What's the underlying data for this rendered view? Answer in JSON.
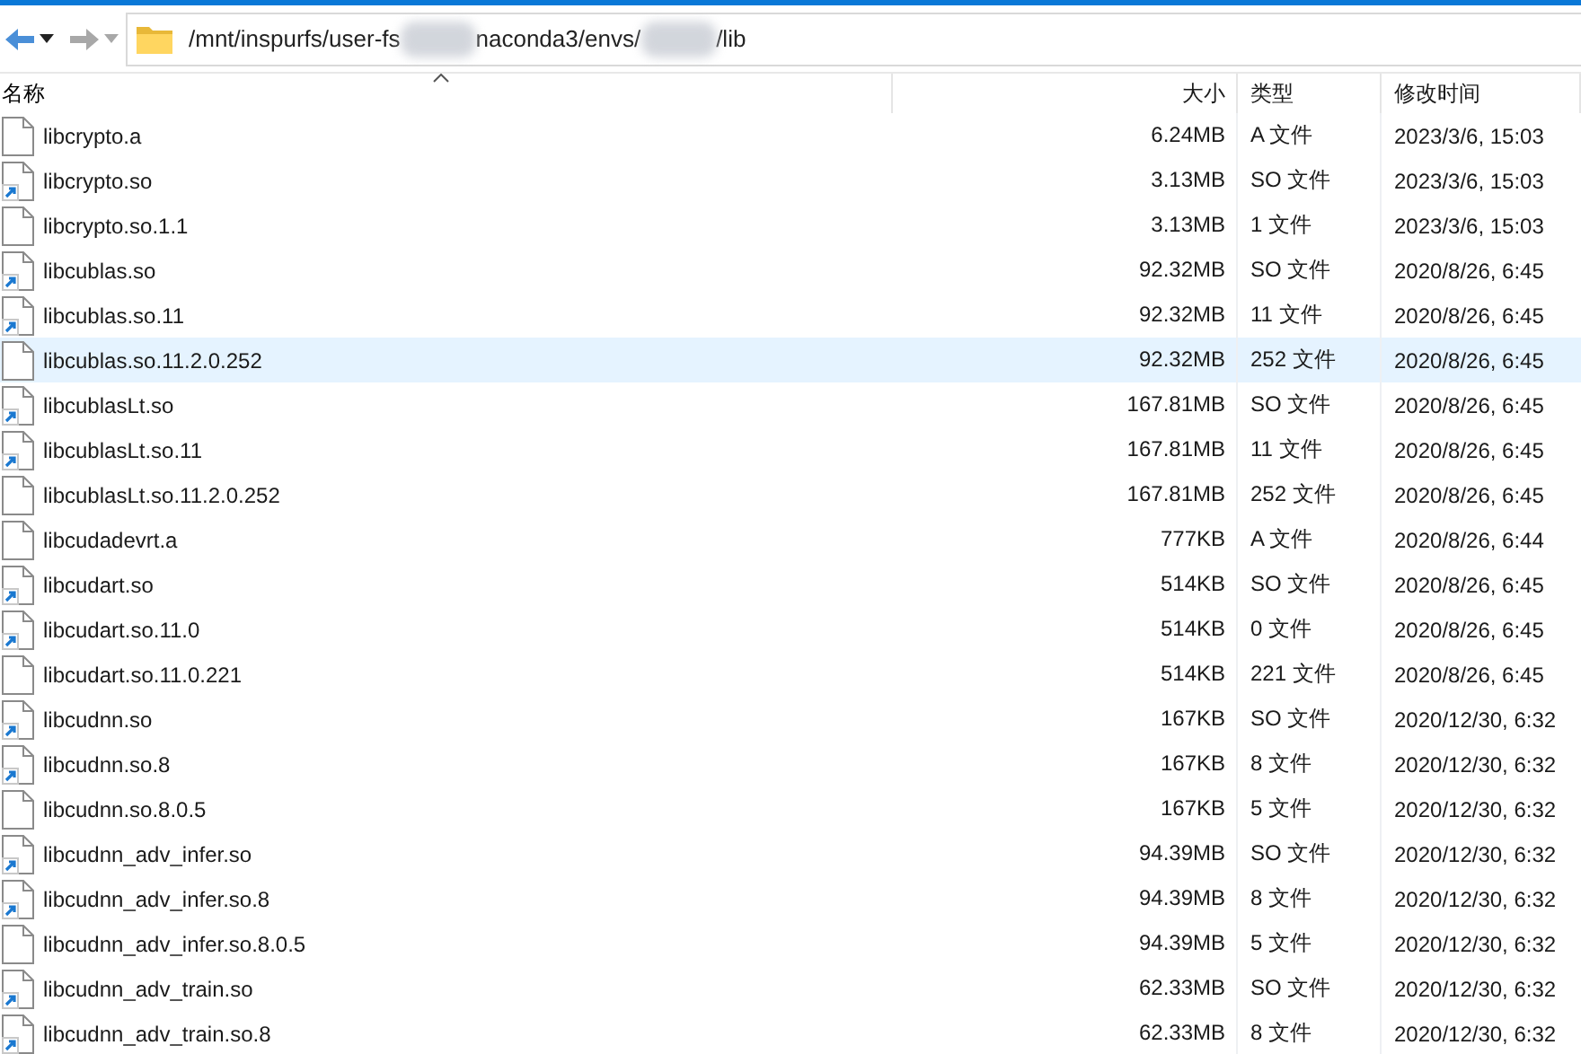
{
  "address_bar": {
    "segments": [
      {
        "kind": "text",
        "text": "/mnt/inspurfs/user-fs"
      },
      {
        "kind": "blur"
      },
      {
        "kind": "text",
        "text": "naconda3/envs/"
      },
      {
        "kind": "blur"
      },
      {
        "kind": "text",
        "text": "/lib"
      }
    ]
  },
  "nav": {
    "back_disabled": false,
    "forward_disabled": true
  },
  "columns": [
    {
      "label": "名称",
      "sorted": true
    },
    {
      "label": "大小",
      "sorted": false
    },
    {
      "label": "类型",
      "sorted": false
    },
    {
      "label": "修改时间",
      "sorted": false
    }
  ],
  "rows": [
    {
      "name": "libcrypto.a",
      "size": "6.24MB",
      "type": "A 文件",
      "modified": "2023/3/6, 15:03",
      "kind": "file",
      "selected": false
    },
    {
      "name": "libcrypto.so",
      "size": "3.13MB",
      "type": "SO 文件",
      "modified": "2023/3/6, 15:03",
      "kind": "link",
      "selected": false
    },
    {
      "name": "libcrypto.so.1.1",
      "size": "3.13MB",
      "type": "1 文件",
      "modified": "2023/3/6, 15:03",
      "kind": "file",
      "selected": false
    },
    {
      "name": "libcublas.so",
      "size": "92.32MB",
      "type": "SO 文件",
      "modified": "2020/8/26, 6:45",
      "kind": "link",
      "selected": false
    },
    {
      "name": "libcublas.so.11",
      "size": "92.32MB",
      "type": "11 文件",
      "modified": "2020/8/26, 6:45",
      "kind": "link",
      "selected": false
    },
    {
      "name": "libcublas.so.11.2.0.252",
      "size": "92.32MB",
      "type": "252 文件",
      "modified": "2020/8/26, 6:45",
      "kind": "file",
      "selected": true
    },
    {
      "name": "libcublasLt.so",
      "size": "167.81MB",
      "type": "SO 文件",
      "modified": "2020/8/26, 6:45",
      "kind": "link",
      "selected": false
    },
    {
      "name": "libcublasLt.so.11",
      "size": "167.81MB",
      "type": "11 文件",
      "modified": "2020/8/26, 6:45",
      "kind": "link",
      "selected": false
    },
    {
      "name": "libcublasLt.so.11.2.0.252",
      "size": "167.81MB",
      "type": "252 文件",
      "modified": "2020/8/26, 6:45",
      "kind": "file",
      "selected": false
    },
    {
      "name": "libcudadevrt.a",
      "size": "777KB",
      "type": "A 文件",
      "modified": "2020/8/26, 6:44",
      "kind": "file",
      "selected": false
    },
    {
      "name": "libcudart.so",
      "size": "514KB",
      "type": "SO 文件",
      "modified": "2020/8/26, 6:45",
      "kind": "link",
      "selected": false
    },
    {
      "name": "libcudart.so.11.0",
      "size": "514KB",
      "type": "0 文件",
      "modified": "2020/8/26, 6:45",
      "kind": "link",
      "selected": false
    },
    {
      "name": "libcudart.so.11.0.221",
      "size": "514KB",
      "type": "221 文件",
      "modified": "2020/8/26, 6:45",
      "kind": "file",
      "selected": false
    },
    {
      "name": "libcudnn.so",
      "size": "167KB",
      "type": "SO 文件",
      "modified": "2020/12/30, 6:32",
      "kind": "link",
      "selected": false
    },
    {
      "name": "libcudnn.so.8",
      "size": "167KB",
      "type": "8 文件",
      "modified": "2020/12/30, 6:32",
      "kind": "link",
      "selected": false
    },
    {
      "name": "libcudnn.so.8.0.5",
      "size": "167KB",
      "type": "5 文件",
      "modified": "2020/12/30, 6:32",
      "kind": "file",
      "selected": false
    },
    {
      "name": "libcudnn_adv_infer.so",
      "size": "94.39MB",
      "type": "SO 文件",
      "modified": "2020/12/30, 6:32",
      "kind": "link",
      "selected": false
    },
    {
      "name": "libcudnn_adv_infer.so.8",
      "size": "94.39MB",
      "type": "8 文件",
      "modified": "2020/12/30, 6:32",
      "kind": "link",
      "selected": false
    },
    {
      "name": "libcudnn_adv_infer.so.8.0.5",
      "size": "94.39MB",
      "type": "5 文件",
      "modified": "2020/12/30, 6:32",
      "kind": "file",
      "selected": false
    },
    {
      "name": "libcudnn_adv_train.so",
      "size": "62.33MB",
      "type": "SO 文件",
      "modified": "2020/12/30, 6:32",
      "kind": "link",
      "selected": false
    },
    {
      "name": "libcudnn_adv_train.so.8",
      "size": "62.33MB",
      "type": "8 文件",
      "modified": "2020/12/30, 6:32",
      "kind": "link",
      "selected": false
    }
  ]
}
